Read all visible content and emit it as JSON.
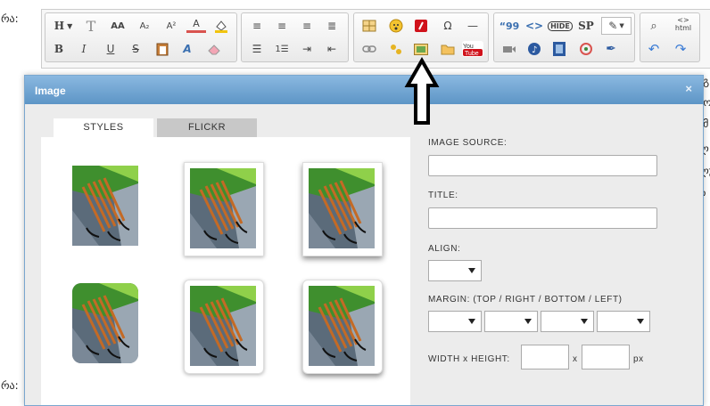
{
  "background": {
    "left_text_top": "რა:",
    "left_text_bottom": "რა:",
    "right_fragments": [
      "ეგ",
      "იო",
      "ვმ",
      "ლ",
      "ლუ",
      "ღ"
    ]
  },
  "toolbar": {
    "format_label": "H",
    "special_char": "Ω",
    "quote_label": "“99",
    "hide_label": "HIDE",
    "sp_label": "SP",
    "html_label": "html",
    "youtube_label": "YouTube"
  },
  "dialog": {
    "title": "Image",
    "close_symbol": "×",
    "tabs": [
      {
        "label": "STYLES",
        "active": true
      },
      {
        "label": "FLICKR",
        "active": false
      }
    ],
    "form": {
      "image_source_label": "IMAGE SOURCE:",
      "image_source_value": "",
      "title_label": "TITLE:",
      "title_value": "",
      "align_label": "ALIGN:",
      "align_value": "",
      "margin_label": "MARGIN: (TOP / RIGHT / BOTTOM / LEFT)",
      "margin_values": [
        "",
        "",
        "",
        ""
      ],
      "size_label": "WIDTH x HEIGHT:",
      "width_value": "",
      "height_value": "",
      "size_separator": "x",
      "unit": "px"
    },
    "style_thumbnails": [
      "plain",
      "white-border",
      "border-shadow",
      "rounded",
      "border-soft-shadow",
      "border-shadow-2"
    ]
  },
  "colors": {
    "titlebar": "#6fa3d2",
    "dialog_bg": "#ececec",
    "arrow": "#000000"
  }
}
